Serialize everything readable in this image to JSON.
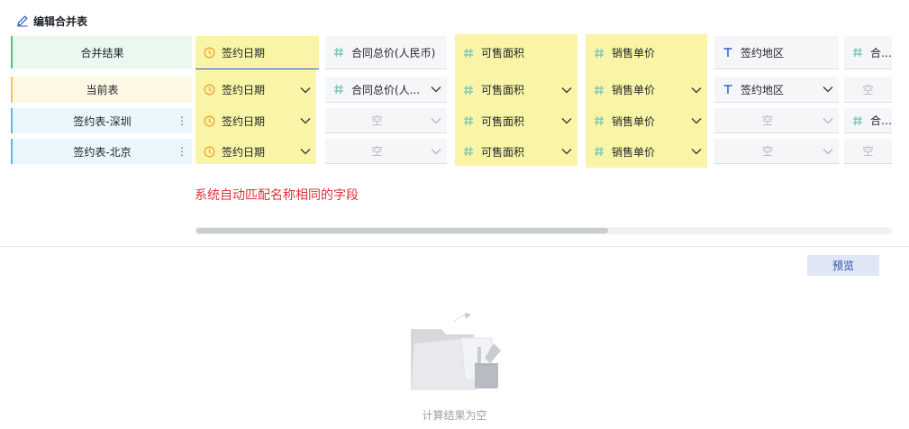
{
  "header": {
    "title": "编辑合并表",
    "icon": "edit-icon"
  },
  "rows": {
    "merge_result": "合并结果",
    "current": "当前表",
    "shenzhen": "签约表-深圳",
    "beijing": "签约表-北京"
  },
  "columns": [
    {
      "name": "签约日期",
      "type": "date"
    },
    {
      "name": "合同总价(人民币)",
      "type": "number"
    },
    {
      "name": "可售面积",
      "type": "number"
    },
    {
      "name": "销售单价",
      "type": "number"
    },
    {
      "name": "签约地区",
      "type": "text"
    },
    {
      "name": "合同总价(人民币)",
      "type": "number"
    }
  ],
  "current_row": [
    "签约日期",
    "合同总价(人...",
    "可售面积",
    "销售单价",
    "签约地区",
    "空"
  ],
  "shenzhen_row": [
    "签约日期",
    "空",
    "可售面积",
    "销售单价",
    "空",
    "合同总"
  ],
  "beijing_row": [
    "签约日期",
    "空",
    "可售面积",
    "销售单价",
    "空",
    "空"
  ],
  "header_col6_visible": "合同总",
  "hint": "系统自动匹配名称相同的字段",
  "preview_label": "预览",
  "empty_state": "计算结果为空",
  "colors": {
    "highlight": "#f9f4a6",
    "hint_red": "#e0303a",
    "accent_blue": "#2e5ac8",
    "merge_result_border": "#4cc38a",
    "current_border": "#f2c94c",
    "table_border": "#5ab8e6"
  }
}
